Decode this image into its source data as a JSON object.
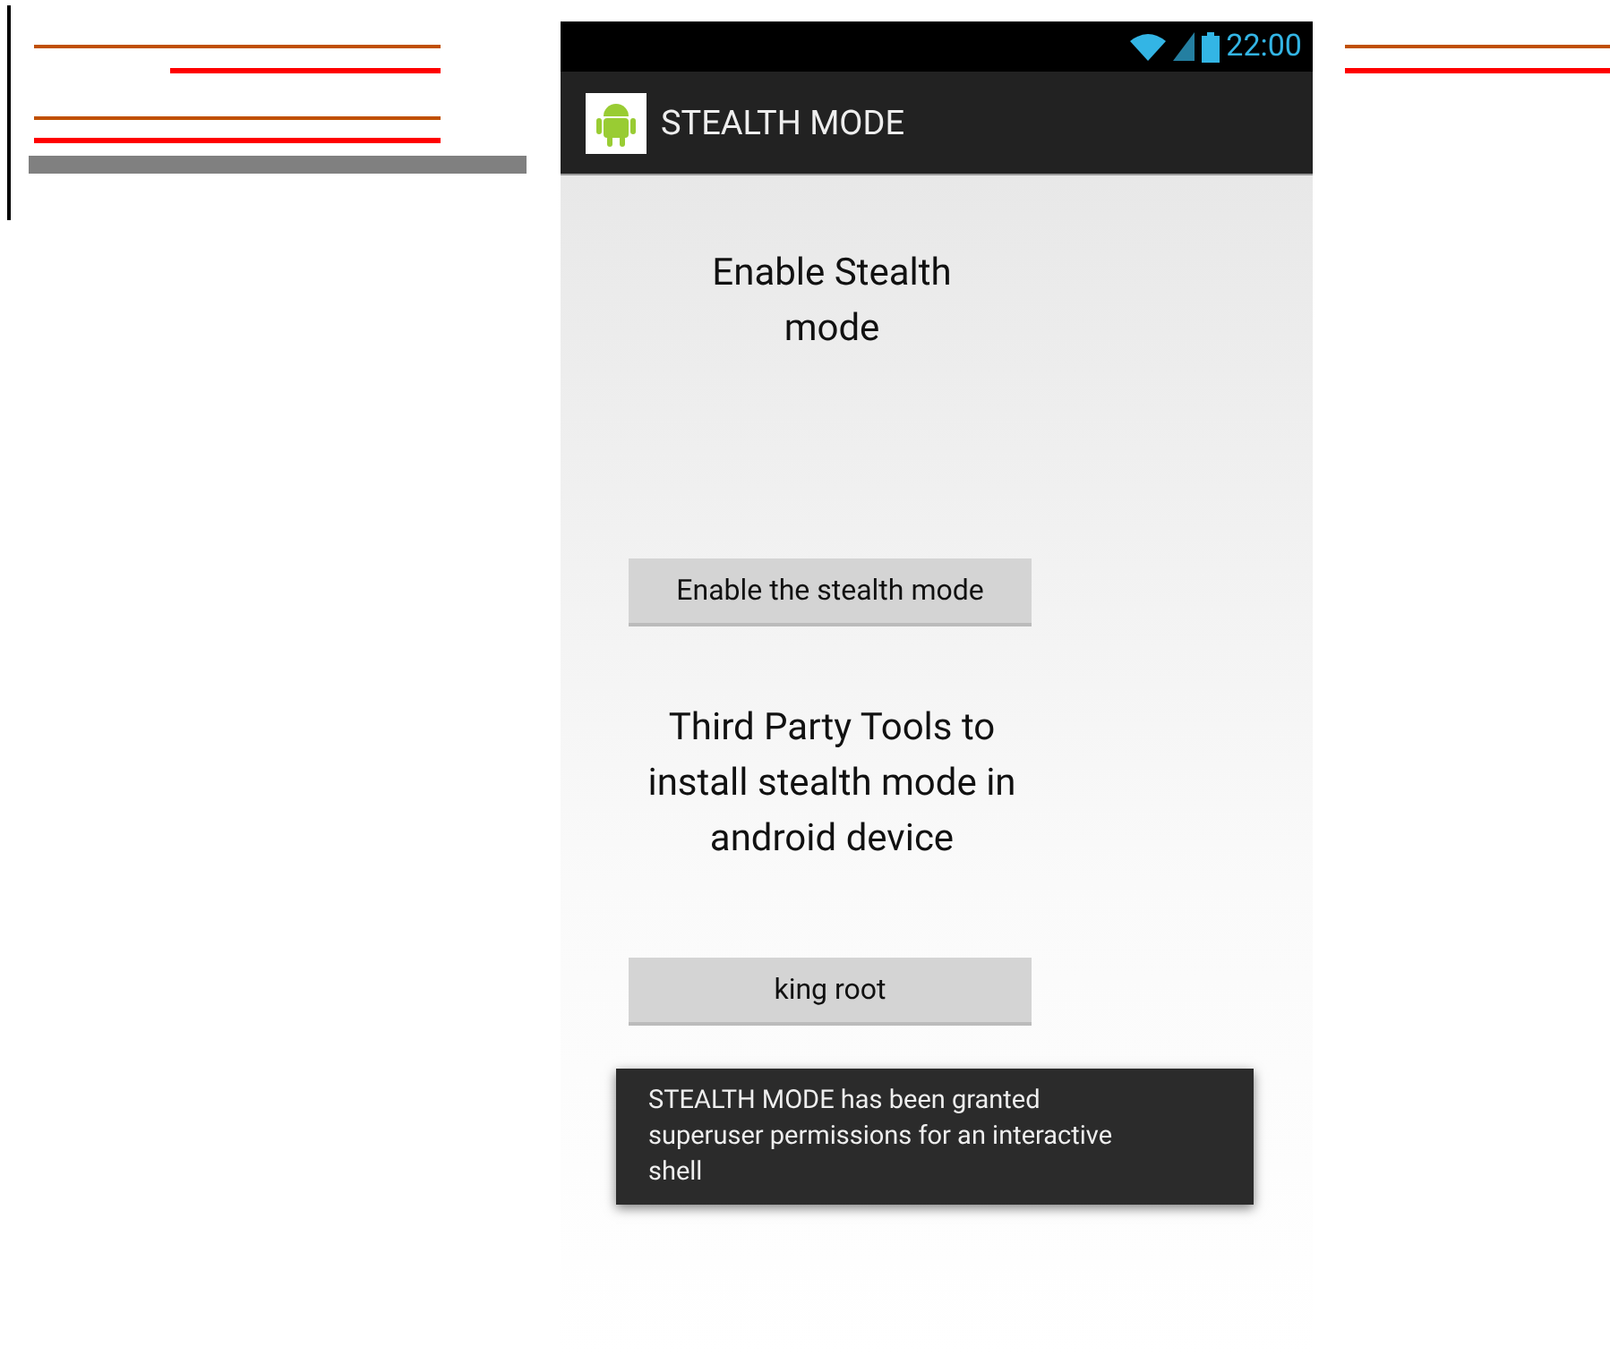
{
  "status_bar": {
    "time": "22:00"
  },
  "action_bar": {
    "title": "STEALTH MODE"
  },
  "content": [
    {
      "kind": "title",
      "text": "Enable Stealth mode"
    },
    {
      "kind": "button",
      "text": "Enable the stealth mode"
    },
    {
      "kind": "heading",
      "text": "Third Party Tools to install stealth mode in android device"
    },
    {
      "kind": "button",
      "text": "king root"
    }
  ],
  "toast": {
    "message": "STEALTH MODE has been granted superuser permissions for an interactive shell"
  }
}
